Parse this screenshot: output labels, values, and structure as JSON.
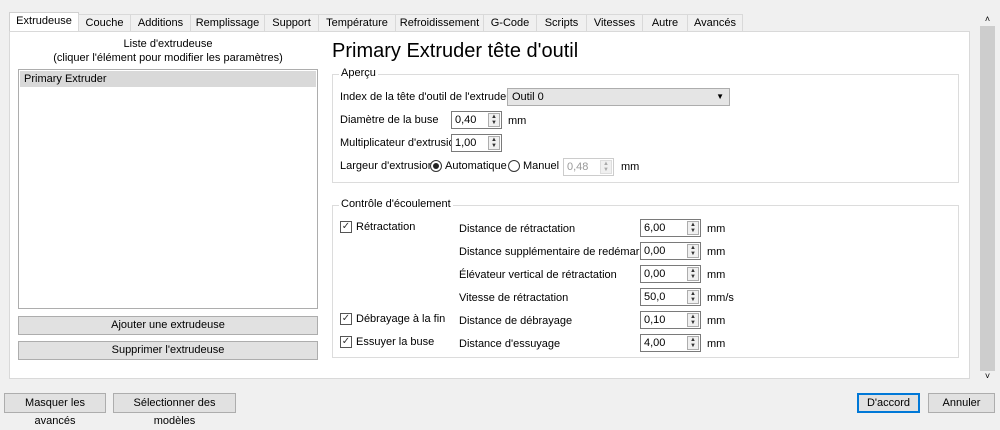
{
  "tabs": [
    "Extrudeuse",
    "Couche",
    "Additions",
    "Remplissage",
    "Support",
    "Température",
    "Refroidissement",
    "G-Code",
    "Scripts",
    "Vitesses",
    "Autre",
    "Avancés"
  ],
  "active_tab": "Extrudeuse",
  "left": {
    "title1": "Liste d'extrudeuse",
    "title2": "(cliquer l'élément pour modifier les paramètres)",
    "items": [
      "Primary Extruder"
    ],
    "add_button": "Ajouter une extrudeuse",
    "remove_button": "Supprimer l'extrudeuse"
  },
  "right": {
    "title": "Primary Extruder tête d'outil",
    "apercu": {
      "label": "Aperçu",
      "index_label": "Index de la tête d'outil de l'extrudeuse",
      "index_value": "Outil 0",
      "diam_label": "Diamètre de la buse",
      "diam_value": "0,40",
      "diam_unit": "mm",
      "mult_label": "Multiplicateur d'extrusion",
      "mult_value": "1,00",
      "width_label": "Largeur d'extrusion",
      "auto_label": "Automatique",
      "manual_label": "Manuel",
      "manual_value": "0,48",
      "width_unit": "mm",
      "auto_selected": true
    },
    "flow": {
      "label": "Contrôle d'écoulement",
      "checks": [
        {
          "label": "Rétractation",
          "checked": true
        },
        {
          "label": "Débrayage à la fin",
          "checked": true
        },
        {
          "label": "Essuyer la buse",
          "checked": true
        }
      ],
      "rows": [
        {
          "label": "Distance de rétractation",
          "value": "6,00",
          "unit": "mm"
        },
        {
          "label": "Distance supplémentaire de redémarrage",
          "value": "0,00",
          "unit": "mm"
        },
        {
          "label": "Élévateur vertical de rétractation",
          "value": "0,00",
          "unit": "mm"
        },
        {
          "label": "Vitesse de rétractation",
          "value": "50,0",
          "unit": "mm/s"
        },
        {
          "label": "Distance de débrayage",
          "value": "0,10",
          "unit": "mm"
        },
        {
          "label": "Distance d'essuyage",
          "value": "4,00",
          "unit": "mm"
        }
      ]
    }
  },
  "footer": {
    "hide_advanced": "Masquer les avancés",
    "select_models": "Sélectionner des modèles",
    "ok": "D'accord",
    "cancel": "Annuler"
  },
  "colors": {
    "accent": "#0078d7",
    "selected_row": "#d9d9d9"
  }
}
